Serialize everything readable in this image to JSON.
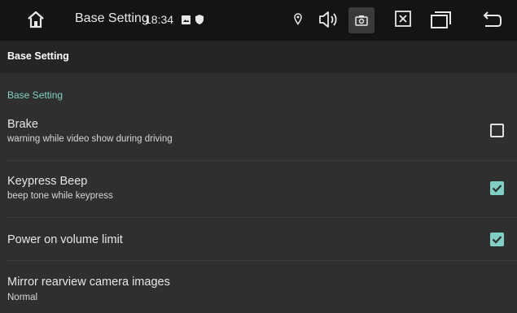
{
  "status_bar": {
    "title": "Base Setting",
    "time": "18:34",
    "icons": [
      "home-icon",
      "image-icon",
      "shield-icon",
      "location-icon",
      "volume-icon",
      "camera-icon",
      "close-icon",
      "recent-apps-icon",
      "back-icon"
    ]
  },
  "app_bar": {
    "title": "Base Setting"
  },
  "section": {
    "header": "Base Setting"
  },
  "settings": {
    "brake": {
      "title": "Brake",
      "summary": "warning while video show during driving",
      "checked": false
    },
    "keypress_beep": {
      "title": "Keypress Beep",
      "summary": "beep tone while keypress",
      "checked": true
    },
    "power_volume": {
      "title": "Power on volume limit",
      "checked": true
    },
    "mirror_camera": {
      "title": "Mirror rearview camera images",
      "summary": "Normal"
    }
  },
  "colors": {
    "accent": "#7fcfc4",
    "background": "#2f2f2f",
    "status_bar": "#141414",
    "app_bar": "#252525"
  }
}
